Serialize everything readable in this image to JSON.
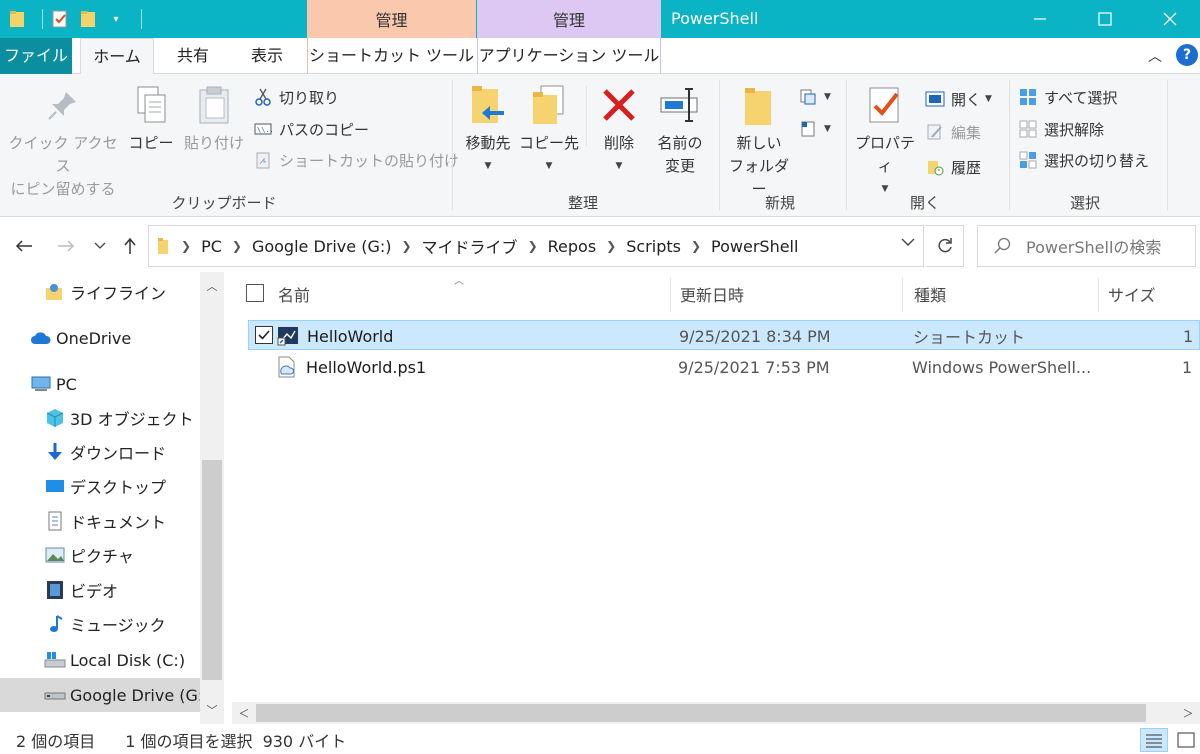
{
  "titlebar": {
    "context_tab_a": "管理",
    "context_tab_b": "管理",
    "window_title": "PowerShell",
    "minimize_glyph": "—",
    "maximize_glyph": "☐",
    "close_glyph": "✕"
  },
  "tabs": {
    "file": "ファイル",
    "home": "ホーム",
    "share": "共有",
    "view": "表示",
    "shortcut_tools": "ショートカット ツール",
    "application_tools": "アプリケーション ツール"
  },
  "ribbon": {
    "clipboard": {
      "pin_line1": "クイック アクセス",
      "pin_line2": "にピン留めする",
      "copy": "コピー",
      "paste": "貼り付け",
      "cut": "切り取り",
      "copy_path": "パスのコピー",
      "paste_shortcut": "ショートカットの貼り付け",
      "label": "クリップボード"
    },
    "organize": {
      "move_to": "移動先",
      "copy_to": "コピー先",
      "delete": "削除",
      "rename_line1": "名前の",
      "rename_line2": "変更",
      "label": "整理"
    },
    "new": {
      "new_folder_line1": "新しい",
      "new_folder_line2": "フォルダー",
      "label": "新規"
    },
    "open": {
      "properties": "プロパティ",
      "open": "開く",
      "edit": "編集",
      "history": "履歴",
      "label": "開く"
    },
    "select": {
      "select_all": "すべて選択",
      "select_none": "選択解除",
      "invert_selection": "選択の切り替え",
      "label": "選択"
    }
  },
  "address": {
    "crumbs": [
      "PC",
      "Google Drive (G:)",
      "マイドライブ",
      "Repos",
      "Scripts",
      "PowerShell"
    ],
    "search_placeholder": "PowerShellの検索"
  },
  "navpane": {
    "items": [
      {
        "label": "ライフライン",
        "icon": "user-folder-icon"
      },
      {
        "label": "OneDrive",
        "icon": "onedrive-cloud-icon"
      },
      {
        "label": "PC",
        "icon": "pc-icon"
      },
      {
        "label": "3D オブジェクト",
        "icon": "3d-objects-icon"
      },
      {
        "label": "ダウンロード",
        "icon": "download-icon"
      },
      {
        "label": "デスクトップ",
        "icon": "desktop-icon"
      },
      {
        "label": "ドキュメント",
        "icon": "documents-icon"
      },
      {
        "label": "ピクチャ",
        "icon": "pictures-icon"
      },
      {
        "label": "ビデオ",
        "icon": "videos-icon"
      },
      {
        "label": "ミュージック",
        "icon": "music-icon"
      },
      {
        "label": "Local Disk (C:)",
        "icon": "local-disk-icon"
      },
      {
        "label": "Google Drive (G:)",
        "icon": "drive-icon"
      }
    ]
  },
  "filelist": {
    "columns": {
      "name": "名前",
      "date": "更新日時",
      "type": "種類",
      "size": "サイズ"
    },
    "rows": [
      {
        "name": "HelloWorld",
        "date": "9/25/2021 8:34 PM",
        "type": "ショートカット",
        "size": "1",
        "selected": true
      },
      {
        "name": "HelloWorld.ps1",
        "date": "9/25/2021 7:53 PM",
        "type": "Windows PowerShell...",
        "size": "1",
        "selected": false
      }
    ]
  },
  "status": {
    "item_count": "2 個の項目",
    "selection": "1 個の項目を選択",
    "size": "930 バイト"
  },
  "colors": {
    "titlebar": "#0ab4c4",
    "file_tab": "#0b8fa0",
    "context_a": "#f9c8ad",
    "context_b": "#dcc8f2",
    "selection": "#cce8ff"
  }
}
